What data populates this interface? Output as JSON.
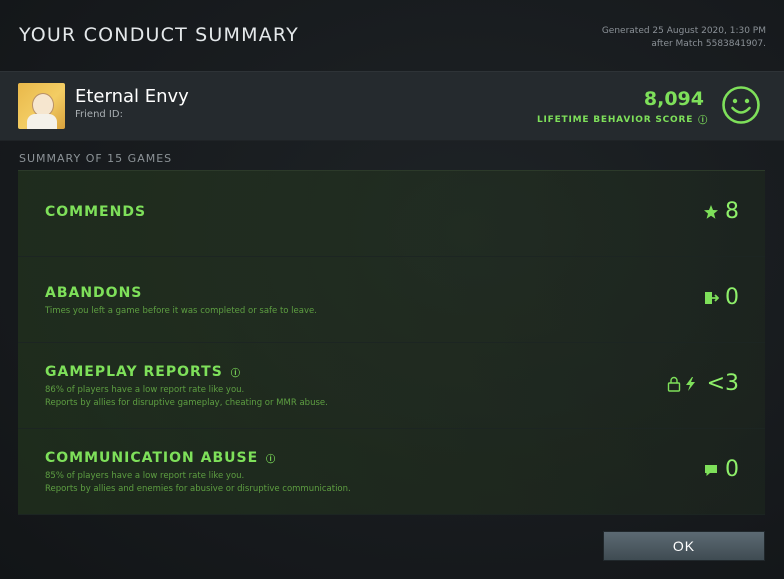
{
  "header": {
    "title": "YOUR CONDUCT SUMMARY",
    "generated": "Generated 25 August 2020, 1:30 PM",
    "after_match": "after Match 5583841907."
  },
  "profile": {
    "name": "Eternal Envy",
    "friend_id_label": "Friend ID:",
    "score": "8,094",
    "score_label": "LIFETIME BEHAVIOR SCORE",
    "icons": {
      "avatar": "avatar-image",
      "score_info": "info-icon",
      "smiley": "smiley-face-icon"
    }
  },
  "summary_label": "SUMMARY OF 15 GAMES",
  "rows": [
    {
      "title": "COMMENDS",
      "desc1": "",
      "desc2": "",
      "value": "8",
      "icon": "commend-star-icon"
    },
    {
      "title": "ABANDONS",
      "desc1": "Times you left a game before it was completed or safe to leave.",
      "desc2": "",
      "value": "0",
      "icon": "exit-door-icon"
    },
    {
      "title": "GAMEPLAY REPORTS",
      "desc1": "86% of players have a low report rate like you.",
      "desc2": "Reports by allies for disruptive gameplay, cheating or MMR abuse.",
      "value": "<3",
      "icon": "lock-and-lightning-icon"
    },
    {
      "title": "COMMUNICATION ABUSE",
      "desc1": "85% of players have a low report rate like you.",
      "desc2": "Reports by allies and enemies for abusive or disruptive communication.",
      "value": "0",
      "icon": "chat-bubble-icon"
    }
  ],
  "ok_button": "OK",
  "colors": {
    "accent_green": "#7ee05a",
    "background": "#15191c",
    "panel": "#252a2e"
  }
}
